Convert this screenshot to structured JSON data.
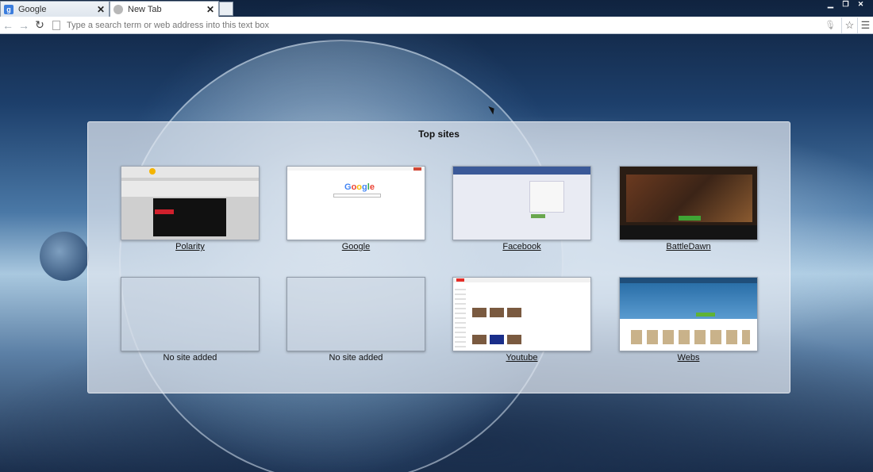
{
  "tabs": [
    {
      "title": "Google",
      "favicon": "google-favicon",
      "active": false
    },
    {
      "title": "New Tab",
      "favicon": "new-tab-favicon",
      "active": true
    }
  ],
  "window_controls": [
    "minimize",
    "restore",
    "close"
  ],
  "toolbar": {
    "back_icon": "back-arrow-icon",
    "forward_icon": "forward-arrow-icon",
    "reload_icon": "reload-icon",
    "address_placeholder": "Type a search term or web address into this text box",
    "bookmark_icon": "star-icon",
    "menu_icon": "menu-icon"
  },
  "top_sites": {
    "title": "Top sites",
    "sites": [
      {
        "label": "Polarity",
        "thumb": "polarity"
      },
      {
        "label": "Google",
        "thumb": "google"
      },
      {
        "label": "Facebook",
        "thumb": "facebook"
      },
      {
        "label": "BattleDawn",
        "thumb": "battledawn"
      },
      {
        "label": "No site added",
        "thumb": "empty"
      },
      {
        "label": "No site added",
        "thumb": "empty"
      },
      {
        "label": "Youtube",
        "thumb": "youtube"
      },
      {
        "label": "Webs",
        "thumb": "webs"
      }
    ]
  },
  "colors": {
    "facebook_blue": "#3b5998",
    "google_red": "#d14836",
    "youtube_red": "#e52d27"
  }
}
